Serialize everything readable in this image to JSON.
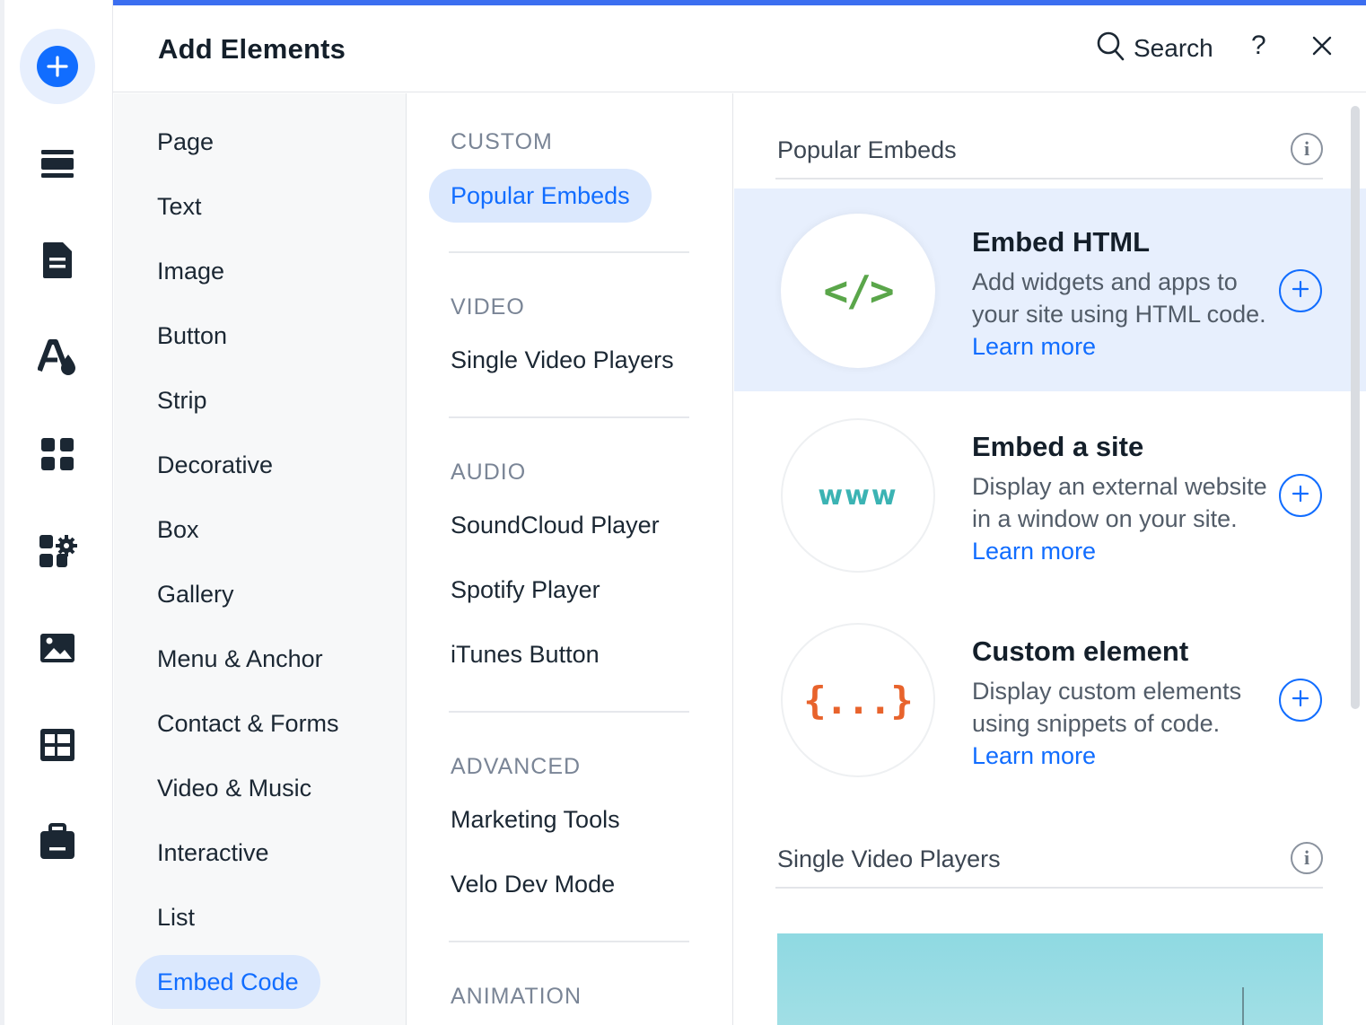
{
  "header": {
    "title": "Add Elements",
    "search_label": "Search",
    "help_label": "?"
  },
  "rail": {
    "icons": [
      "add-icon",
      "sections-icon",
      "pages-icon",
      "design-icon",
      "apps-icon",
      "add-apps-icon",
      "media-icon",
      "cms-icon",
      "business-icon"
    ]
  },
  "categories": [
    {
      "label": "Page"
    },
    {
      "label": "Text"
    },
    {
      "label": "Image"
    },
    {
      "label": "Button"
    },
    {
      "label": "Strip"
    },
    {
      "label": "Decorative"
    },
    {
      "label": "Box"
    },
    {
      "label": "Gallery"
    },
    {
      "label": "Menu & Anchor"
    },
    {
      "label": "Contact & Forms"
    },
    {
      "label": "Video & Music"
    },
    {
      "label": "Interactive"
    },
    {
      "label": "List"
    },
    {
      "label": "Embed Code"
    }
  ],
  "active_category": "Embed Code",
  "subcategories": {
    "custom": {
      "heading": "CUSTOM",
      "items": [
        "Popular Embeds"
      ]
    },
    "video": {
      "heading": "VIDEO",
      "items": [
        "Single Video Players"
      ]
    },
    "audio": {
      "heading": "AUDIO",
      "items": [
        "SoundCloud Player",
        "Spotify Player",
        "iTunes Button"
      ]
    },
    "advanced": {
      "heading": "ADVANCED",
      "items": [
        "Marketing Tools",
        "Velo Dev Mode"
      ]
    },
    "animation": {
      "heading": "ANIMATION",
      "items": []
    }
  },
  "active_subcategory": "Popular Embeds",
  "content": {
    "sections": [
      {
        "title": "Popular Embeds"
      },
      {
        "title": "Single Video Players"
      }
    ],
    "cards": [
      {
        "title": "Embed HTML",
        "description": "Add widgets and apps to your site using HTML code.",
        "link": "Learn more",
        "glyph": "</>",
        "accent": "#5aa64a"
      },
      {
        "title": "Embed a site",
        "description": "Display an external website in a window on your site.",
        "link": "Learn more",
        "glyph": "www",
        "accent": "#3bb3b3"
      },
      {
        "title": "Custom element",
        "description": "Display custom elements using snippets of code.",
        "link": "Learn more",
        "glyph": "{...}",
        "accent": "#e8632c"
      }
    ]
  },
  "colors": {
    "accent": "#116dff",
    "active_bg": "#dbe8fd",
    "highlight_bg": "#e7effd"
  }
}
